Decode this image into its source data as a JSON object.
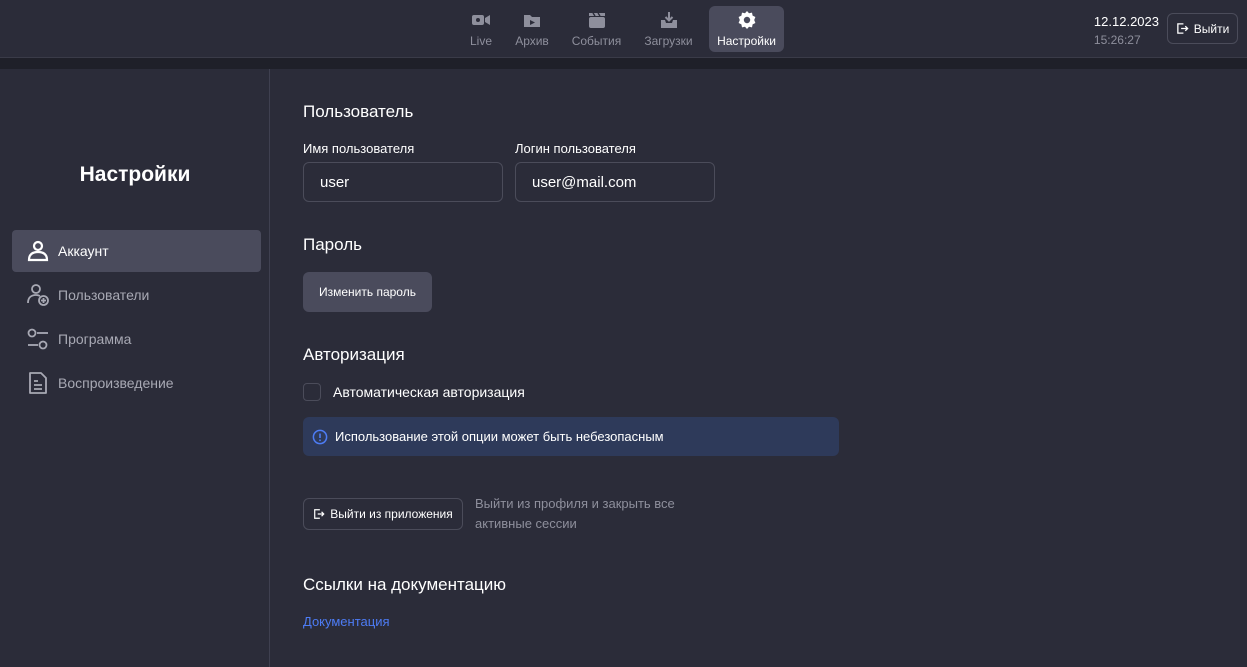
{
  "topbar": {
    "nav": [
      {
        "label": "Live",
        "icon": "camera-icon",
        "active": false
      },
      {
        "label": "Архив",
        "icon": "archive-folder-icon",
        "active": false
      },
      {
        "label": "События",
        "icon": "events-clapper-icon",
        "active": false
      },
      {
        "label": "Загрузки",
        "icon": "download-tray-icon",
        "active": false
      },
      {
        "label": "Настройки",
        "icon": "gear-icon",
        "active": true
      }
    ],
    "date": "12.12.2023",
    "time": "15:26:27",
    "logout_label": "Выйти"
  },
  "sidebar": {
    "title": "Настройки",
    "items": [
      {
        "label": "Аккаунт",
        "icon": "user-icon",
        "active": true
      },
      {
        "label": "Пользователи",
        "icon": "add-user-icon",
        "active": false
      },
      {
        "label": "Программа",
        "icon": "sliders-icon",
        "active": false
      },
      {
        "label": "Воспроизведение",
        "icon": "document-icon",
        "active": false
      }
    ]
  },
  "main": {
    "user_section": {
      "title": "Пользователь",
      "name_label": "Имя пользователя",
      "name_value": "user",
      "login_label": "Логин пользователя",
      "login_value": "user@mail.com"
    },
    "password_section": {
      "title": "Пароль",
      "change_button": "Изменить пароль"
    },
    "auth_section": {
      "title": "Авторизация",
      "auto_auth_label": "Автоматическая авторизация",
      "auto_auth_checked": false,
      "warning": "Использование этой опции может быть небезопасным"
    },
    "exit_section": {
      "button": "Выйти из приложения",
      "description": "Выйти из профиля и закрыть все активные сессии"
    },
    "docs_section": {
      "title": "Ссылки на документацию",
      "link": "Документация"
    }
  },
  "colors": {
    "background": "#2b2c39",
    "active": "#4a4b5c",
    "info_bg": "#2e3a5a",
    "link": "#4d7cf5",
    "muted": "#8e8f9c"
  }
}
